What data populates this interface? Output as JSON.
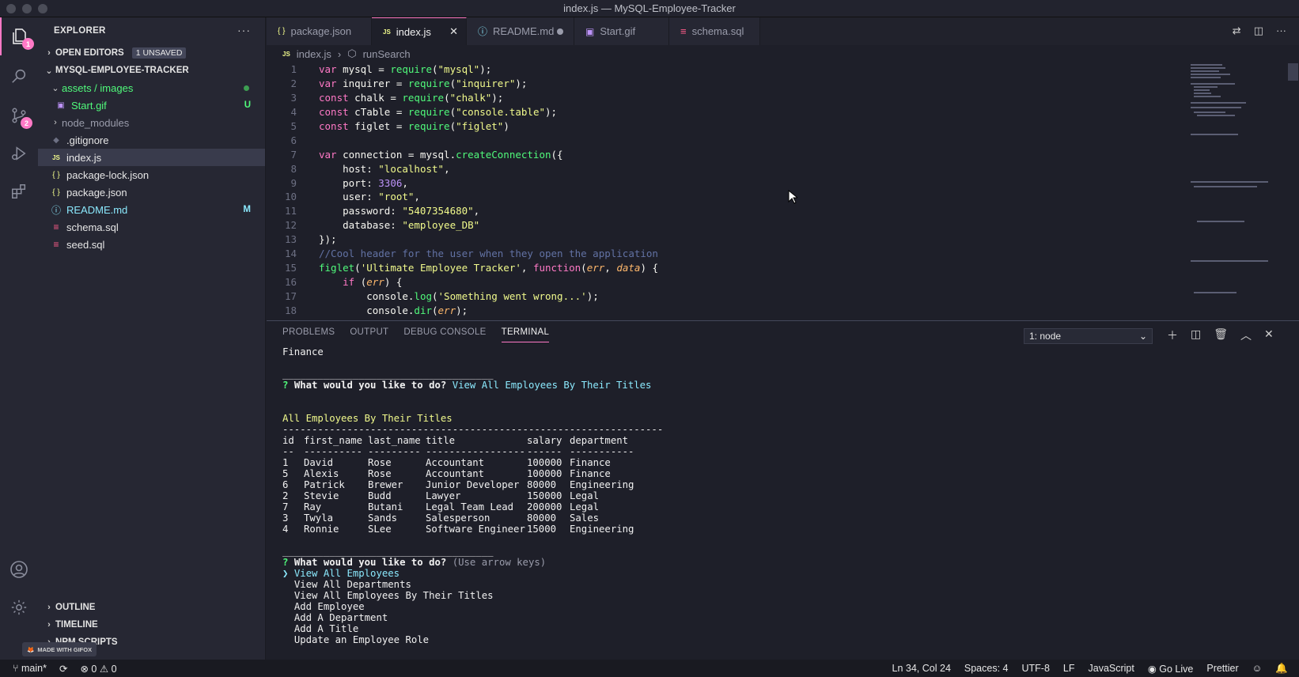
{
  "window": {
    "title": "index.js — MySQL-Employee-Tracker"
  },
  "activity_bar": {
    "explorer_badge": "1",
    "scm_badge": "2"
  },
  "sidebar": {
    "title": "EXPLORER",
    "open_editors": {
      "label": "OPEN EDITORS",
      "badge": "1 UNSAVED"
    },
    "project": {
      "label": "MYSQL-EMPLOYEE-TRACKER"
    },
    "tree": [
      {
        "label": "assets / images",
        "icon": "folder-open",
        "color": "#50fa7b"
      },
      {
        "label": "Start.gif",
        "icon": "image-file",
        "tag": "U",
        "color": "#50fa7b"
      },
      {
        "label": "node_modules",
        "icon": "folder-closed",
        "color": "#9a9cab"
      },
      {
        "label": ".gitignore",
        "icon": "git-file",
        "color": "#e6e6e6"
      },
      {
        "label": "index.js",
        "icon": "js-file",
        "color": "#e6e6e6"
      },
      {
        "label": "package-lock.json",
        "icon": "json-file",
        "color": "#e6e6e6"
      },
      {
        "label": "package.json",
        "icon": "json-file",
        "color": "#e6e6e6"
      },
      {
        "label": "README.md",
        "icon": "info-file",
        "tag": "M",
        "color": "#8be9fd"
      },
      {
        "label": "schema.sql",
        "icon": "database-file",
        "color": "#e6e6e6"
      },
      {
        "label": "seed.sql",
        "icon": "database-file",
        "color": "#e6e6e6"
      }
    ],
    "outline": "OUTLINE",
    "timeline": "TIMELINE",
    "npm_scripts": "NPM SCRIPTS"
  },
  "tabs": [
    {
      "label": "package.json",
      "icon": "{ }"
    },
    {
      "label": "index.js",
      "icon": "JS",
      "active": true
    },
    {
      "label": "README.md",
      "icon": "ⓘ",
      "dirty": true
    },
    {
      "label": "Start.gif",
      "icon": "▣"
    },
    {
      "label": "schema.sql",
      "icon": "≡"
    }
  ],
  "breadcrumb": {
    "file": "index.js",
    "symbol": "runSearch"
  },
  "code_lines": [
    "1",
    "2",
    "3",
    "4",
    "5",
    "6",
    "7",
    "8",
    "9",
    "10",
    "11",
    "12",
    "13",
    "14",
    "15",
    "16",
    "17",
    "18"
  ],
  "panel": {
    "tabs": [
      "PROBLEMS",
      "OUTPUT",
      "DEBUG CONSOLE",
      "TERMINAL"
    ],
    "terminal_select": "1: node"
  },
  "terminal": {
    "line_finance": "Finance",
    "separator_short": "____________________________________",
    "prompt_mark": "?",
    "question": "What would you like to do?",
    "answer": "View All Employees By Their Titles",
    "table_title": "All Employees By Their Titles",
    "table_rule": "-----------------------------------------------------------------",
    "headers": [
      "id",
      "first_name",
      "last_name",
      "title",
      "salary",
      "department"
    ],
    "header_rules": [
      "--",
      "----------",
      "---------",
      "-----------------",
      "------",
      "-----------"
    ],
    "rows": [
      [
        "1",
        "David",
        "Rose",
        "Accountant",
        "100000",
        "Finance"
      ],
      [
        "5",
        "Alexis",
        "Rose",
        "Accountant",
        "100000",
        "Finance"
      ],
      [
        "6",
        "Patrick",
        "Brewer",
        "Junior Developer",
        "80000",
        "Engineering"
      ],
      [
        "2",
        "Stevie",
        "Budd",
        "Lawyer",
        "150000",
        "Legal"
      ],
      [
        "7",
        "Ray",
        "Butani",
        "Legal Team Lead",
        "200000",
        "Legal"
      ],
      [
        "3",
        "Twyla",
        "Sands",
        "Salesperson",
        "80000",
        "Sales"
      ],
      [
        "4",
        "Ronnie",
        "SLee",
        "Software Engineer",
        "15000",
        "Engineering"
      ]
    ],
    "hint": "(Use arrow keys)",
    "pointer": "❯",
    "menu": [
      "View All Employees",
      "View All Departments",
      "View All Employees By Their Titles",
      "Add Employee",
      "Add A Department",
      "Add A Title",
      "Update an Employee Role"
    ]
  },
  "status_bar": {
    "branch": "main*",
    "errors": "0",
    "warnings": "0",
    "position": "Ln 34, Col 24",
    "spaces": "Spaces: 4",
    "encoding": "UTF-8",
    "eol": "LF",
    "language": "JavaScript",
    "go_live": "Go Live",
    "prettier": "Prettier"
  },
  "watermark": "MADE WITH GIFOX",
  "colors": {
    "accent": "#ff79c6",
    "string": "#f1fa8c",
    "function": "#50fa7b",
    "number": "#bd93f9",
    "comment": "#6272a4"
  }
}
